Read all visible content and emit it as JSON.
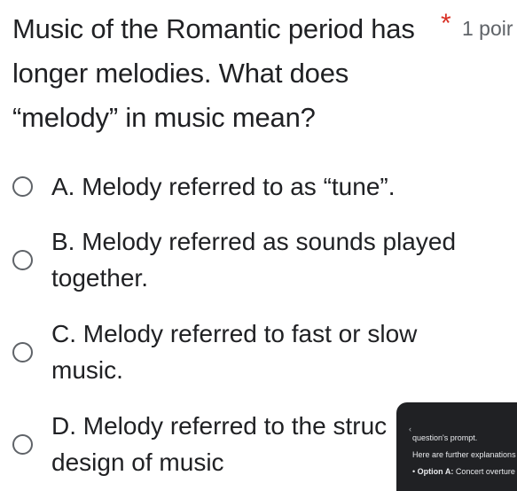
{
  "question": {
    "text": "Music of the Romantic period has longer melodies. What does “melody” in music mean?",
    "required_marker": "*",
    "points": "1 poir"
  },
  "options": [
    {
      "line1": "A. Melody referred to as “tune”.",
      "line2": ""
    },
    {
      "line1": "B. Melody referred as sounds played",
      "line2": "together."
    },
    {
      "line1": "C. Melody referred to fast or slow",
      "line2": "music."
    },
    {
      "line1": "D. Melody referred to the struc",
      "line2": "design of music"
    }
  ],
  "overlay": {
    "back_icon": "‹",
    "prompt_text": "question's prompt.",
    "explain_text": "Here are further explanations",
    "bullet_marker": "•",
    "bullet_label": "Option A:",
    "bullet_text": " Concert overture"
  }
}
